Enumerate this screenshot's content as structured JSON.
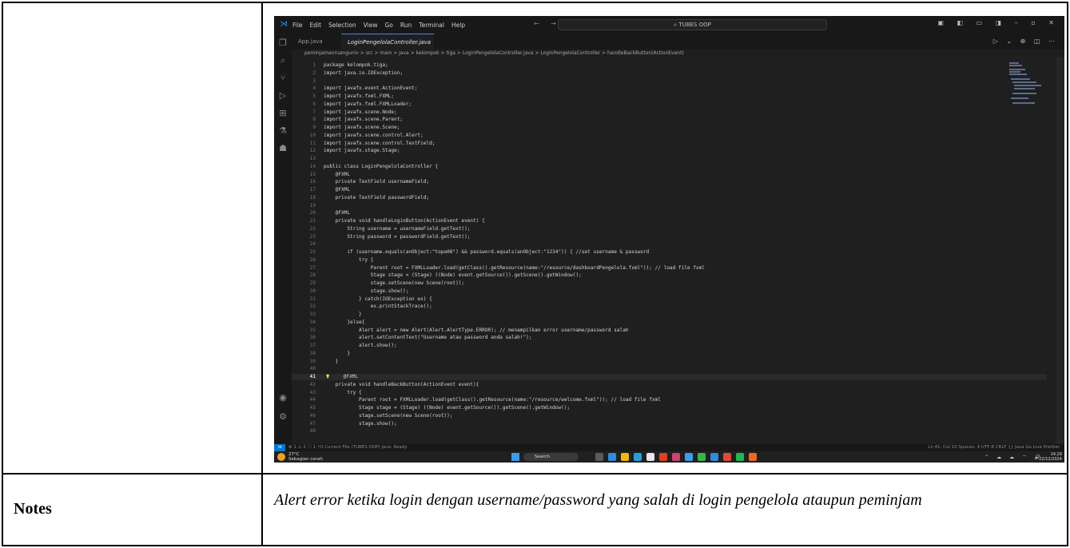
{
  "notes": {
    "label": "Notes",
    "text": "Alert error ketika login dengan username/password yang salah di login pengelola ataupun peminjam"
  },
  "vscode": {
    "menu": [
      "File",
      "Edit",
      "Selection",
      "View",
      "Go",
      "Run",
      "Terminal",
      "Help"
    ],
    "search_box": "TUBES OOP",
    "tabs": [
      {
        "label": "App.java",
        "active": false
      },
      {
        "label": "LoginPengelolaController.java",
        "active": true
      }
    ],
    "breadcrumb": "peminjamanruanguniv > src > main > java > kelompok > tiga > LoginPengelolaController.java > LoginPengelolaController > handleBackButton(ActionEvent)",
    "active_line": 41,
    "code_lines": [
      {
        "n": "1",
        "text": "package kelompok.tiga;"
      },
      {
        "n": "2",
        "text": "import java.io.IOException;"
      },
      {
        "n": "3",
        "text": ""
      },
      {
        "n": "4",
        "text": "import javafx.event.ActionEvent;"
      },
      {
        "n": "5",
        "text": "import javafx.fxml.FXML;"
      },
      {
        "n": "6",
        "text": "import javafx.fxml.FXMLLoader;"
      },
      {
        "n": "7",
        "text": "import javafx.scene.Node;"
      },
      {
        "n": "8",
        "text": "import javafx.scene.Parent;"
      },
      {
        "n": "9",
        "text": "import javafx.scene.Scene;"
      },
      {
        "n": "10",
        "text": "import javafx.scene.control.Alert;"
      },
      {
        "n": "11",
        "text": "import javafx.scene.control.TextField;"
      },
      {
        "n": "12",
        "text": "import javafx.stage.Stage;"
      },
      {
        "n": "13",
        "text": ""
      },
      {
        "n": "14",
        "text": "public class LoginPengelolaController {"
      },
      {
        "n": "15",
        "text": "    @FXML"
      },
      {
        "n": "16",
        "text": "    private TextField usernameField;"
      },
      {
        "n": "17",
        "text": "    @FXML"
      },
      {
        "n": "18",
        "text": "    private TextField passwordField;"
      },
      {
        "n": "19",
        "text": ""
      },
      {
        "n": "20",
        "text": "    @FXML"
      },
      {
        "n": "21",
        "text": "    private void handleLoginButton(ActionEvent event) {"
      },
      {
        "n": "22",
        "text": "        String username = usernameField.getText();"
      },
      {
        "n": "23",
        "text": "        String password = passwordField.getText();"
      },
      {
        "n": "24",
        "text": ""
      },
      {
        "n": "25",
        "text": "        if (username.equals(anObject:\"topa08\") && password.equals(anObject:\"1234\")) { //set username & password"
      },
      {
        "n": "26",
        "text": "            try {"
      },
      {
        "n": "27",
        "text": "                Parent root = FXMLLoader.load(getClass().getResource(name:\"/resource/dashboardPengelola.fxml\")); // load file fxml"
      },
      {
        "n": "28",
        "text": "                Stage stage = (Stage) ((Node) event.getSource()).getScene().getWindow();"
      },
      {
        "n": "29",
        "text": "                stage.setScene(new Scene(root));"
      },
      {
        "n": "30",
        "text": "                stage.show();"
      },
      {
        "n": "31",
        "text": "            } catch(IOException ex) {"
      },
      {
        "n": "32",
        "text": "                ex.printStackTrace();"
      },
      {
        "n": "33",
        "text": "            }"
      },
      {
        "n": "34",
        "text": "        }else{"
      },
      {
        "n": "35",
        "text": "            Alert alert = new Alert(Alert.AlertType.ERROR); // menampilkan error username/password salah"
      },
      {
        "n": "36",
        "text": "            alert.setContentText(\"Username atau password anda salah!\");"
      },
      {
        "n": "37",
        "text": "            alert.show();"
      },
      {
        "n": "38",
        "text": "        }"
      },
      {
        "n": "39",
        "text": "    }"
      },
      {
        "n": "40",
        "text": ""
      },
      {
        "n": "41",
        "text": "    @FXML"
      },
      {
        "n": "42",
        "text": "    private void handleBackButton(ActionEvent event){"
      },
      {
        "n": "43",
        "text": "        try {"
      },
      {
        "n": "44",
        "text": "            Parent root = FXMLLoader.load(getClass().getResource(name:\"/resource/welcome.fxml\")); // load file fxml"
      },
      {
        "n": "45",
        "text": "            Stage stage = (Stage) ((Node) event.getSource()).getScene().getWindow();"
      },
      {
        "n": "46",
        "text": "            stage.setScene(new Scene(root));"
      },
      {
        "n": "47",
        "text": "            stage.show();"
      },
      {
        "n": "48",
        "text": ""
      }
    ],
    "status_left": "⊗ 1 ⚠ 2 ⓘ 1   ⚡0   Current File (TUBES OOP)   Java: Ready",
    "status_right": "Ln 41, Col 10   Spaces: 4   UTF-8   CRLF   {} Java   Go Live   Prettier"
  },
  "taskbar": {
    "weather_temp": "27°C",
    "weather_desc": "Sebagian cerah",
    "search_label": "Search",
    "time": "14:29",
    "date": "22/12/2024",
    "app_colors": [
      "#5a5a5a",
      "#2f8ae0",
      "#f2b705",
      "#1fa2d8",
      "#e8e8e8",
      "#e0401c",
      "#d04070",
      "#3b9cf0",
      "#35b54a",
      "#2f8ae0",
      "#e04a3a",
      "#1db954",
      "#f06a1e"
    ]
  }
}
